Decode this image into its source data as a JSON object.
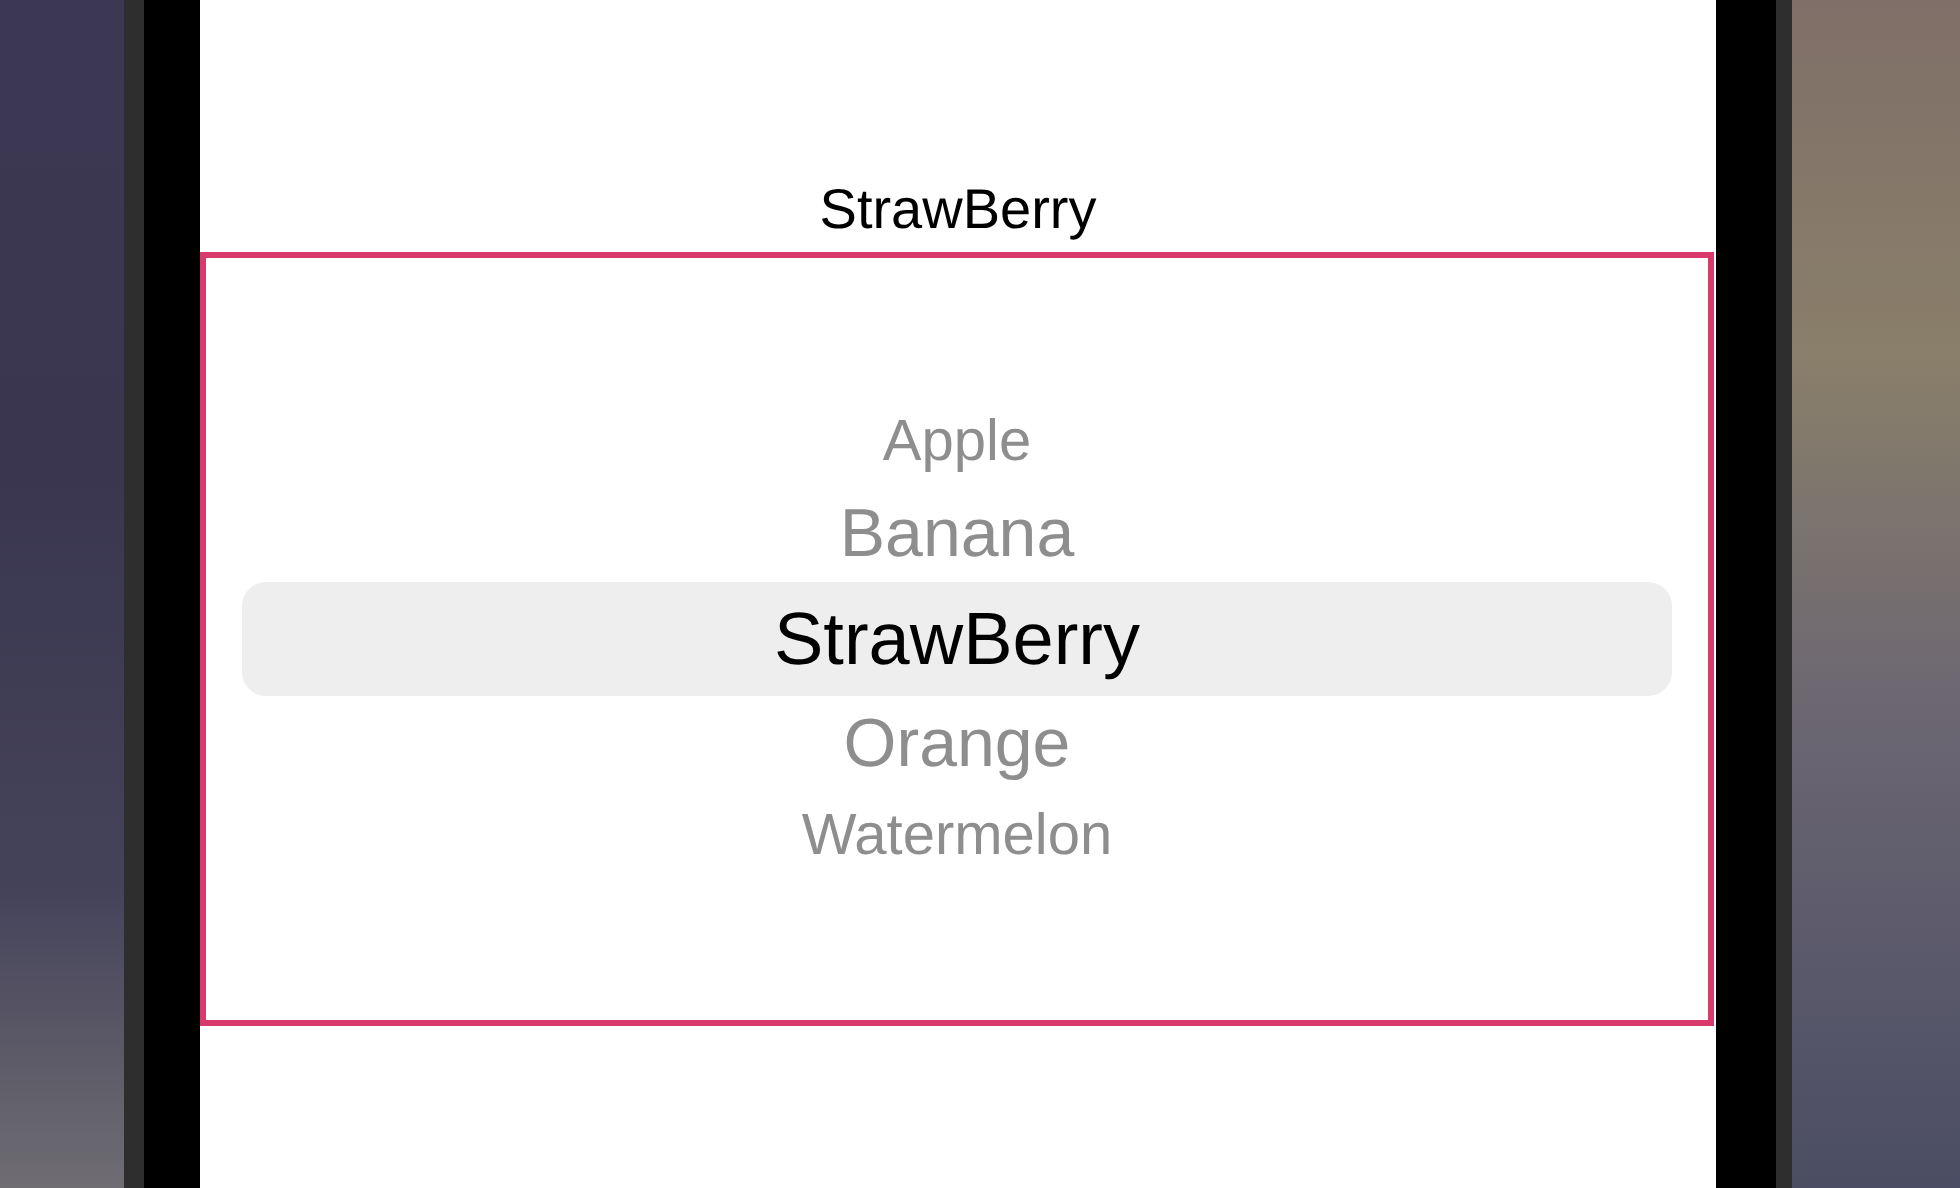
{
  "title": "StrawBerry",
  "picker": {
    "items": [
      {
        "label": "Apple",
        "selected": false
      },
      {
        "label": "Banana",
        "selected": false
      },
      {
        "label": "StrawBerry",
        "selected": true
      },
      {
        "label": "Orange",
        "selected": false
      },
      {
        "label": "Watermelon",
        "selected": false
      }
    ]
  }
}
